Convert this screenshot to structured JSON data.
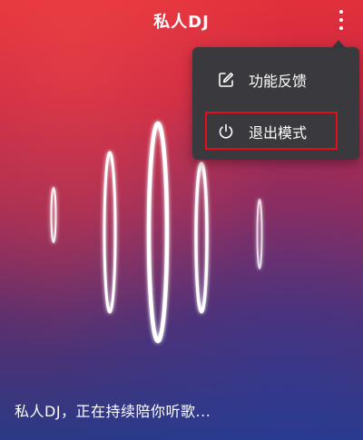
{
  "header": {
    "title": "私人DJ",
    "more_icon": "more-vertical-icon"
  },
  "menu": {
    "items": [
      {
        "label": "功能反馈",
        "icon": "feedback-edit-icon"
      },
      {
        "label": "退出模式",
        "icon": "power-icon",
        "highlighted": true
      }
    ]
  },
  "visualizer": {
    "icon": "sound-wave-rings"
  },
  "status": {
    "caption": "私人DJ，正在持续陪你听歌..."
  },
  "colors": {
    "background_top": "#e1303b",
    "background_bottom": "#2a3a86",
    "menu_background": "#3a3a3e",
    "highlight_border": "#e3101c",
    "text": "#ffffff"
  }
}
